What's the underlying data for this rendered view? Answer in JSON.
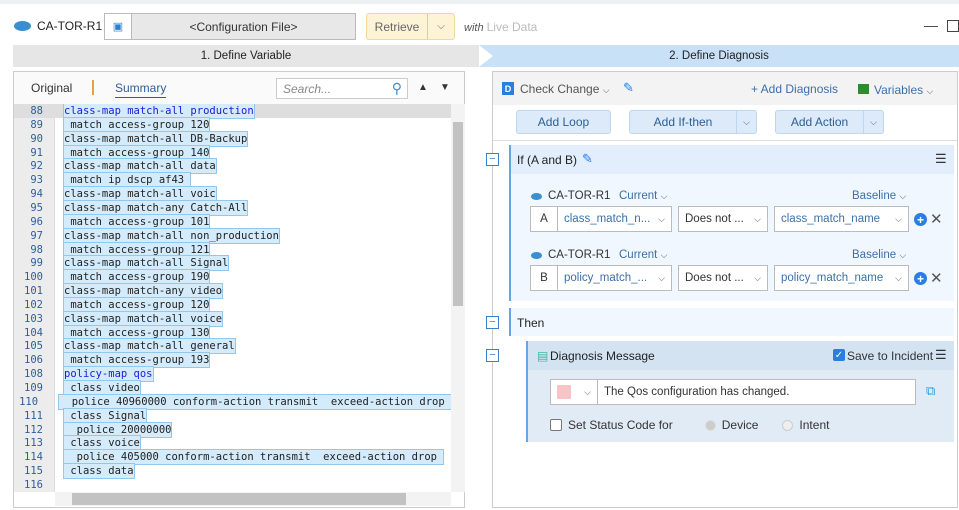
{
  "header": {
    "device": "CA-TOR-R1",
    "config_file": "<Configuration File>",
    "retrieve": "Retrieve",
    "with": "with",
    "live_data": "Live Data"
  },
  "steps": {
    "step1": "1. Define Variable",
    "step2": "2. Define Diagnosis"
  },
  "left": {
    "tab_original": "Original",
    "tab_summary": "Summary",
    "search_placeholder": "Search...",
    "lines": [
      {
        "n": "88",
        "t": "class-map match-all production"
      },
      {
        "n": "89",
        "t": " match access-group 120"
      },
      {
        "n": "90",
        "t": "class-map match-all DB-Backup"
      },
      {
        "n": "91",
        "t": " match access-group 140"
      },
      {
        "n": "92",
        "t": "class-map match-all data"
      },
      {
        "n": "93",
        "t": " match ip dscp af43 "
      },
      {
        "n": "94",
        "t": "class-map match-all voic"
      },
      {
        "n": "95",
        "t": "class-map match-any Catch-All"
      },
      {
        "n": "96",
        "t": " match access-group 101"
      },
      {
        "n": "97",
        "t": "class-map match-all non_production"
      },
      {
        "n": "98",
        "t": " match access-group 121"
      },
      {
        "n": "99",
        "t": "class-map match-all Signal"
      },
      {
        "n": "100",
        "t": " match access-group 190"
      },
      {
        "n": "101",
        "t": "class-map match-any video"
      },
      {
        "n": "102",
        "t": " match access-group 120"
      },
      {
        "n": "103",
        "t": "class-map match-all voice"
      },
      {
        "n": "104",
        "t": " match access-group 130"
      },
      {
        "n": "105",
        "t": "class-map match-all general"
      },
      {
        "n": "106",
        "t": " match access-group 193"
      },
      {
        "n": "108",
        "t": "policy-map qos"
      },
      {
        "n": "109",
        "t": " class video"
      },
      {
        "n": "110",
        "t": "  police 40960000 conform-action transmit  exceed-action drop "
      },
      {
        "n": "111",
        "t": " class Signal"
      },
      {
        "n": "112",
        "t": "  police 20000000"
      },
      {
        "n": "113",
        "t": " class voice"
      },
      {
        "n": "114",
        "t": "  police 405000 conform-action transmit  exceed-action drop "
      },
      {
        "n": "115",
        "t": " class data"
      },
      {
        "n": "116",
        "t": ""
      }
    ]
  },
  "right": {
    "diagnosis_name": "Check Change",
    "add_diagnosis": "+ Add Diagnosis",
    "variables": "Variables",
    "add_loop": "Add Loop",
    "add_ifthen": "Add If-then",
    "add_action": "Add Action",
    "if_title": "If (A and B)",
    "conditions": [
      {
        "device": "CA-TOR-R1",
        "current": "Current",
        "baseline": "Baseline",
        "letter": "A",
        "left": "class_match_n...",
        "op": "Does not ...",
        "right": "class_match_name"
      },
      {
        "device": "CA-TOR-R1",
        "current": "Current",
        "baseline": "Baseline",
        "letter": "B",
        "left": "policy_match_...",
        "op": "Does not ...",
        "right": "policy_match_name"
      }
    ],
    "then": "Then",
    "diag_message_title": "Diagnosis Message",
    "save_to_incident": "Save to Incident",
    "message": "The Qos configuration has changed.",
    "message_color": "#f9c4c8",
    "set_status": "Set Status Code for",
    "device_opt": "Device",
    "intent_opt": "Intent"
  }
}
